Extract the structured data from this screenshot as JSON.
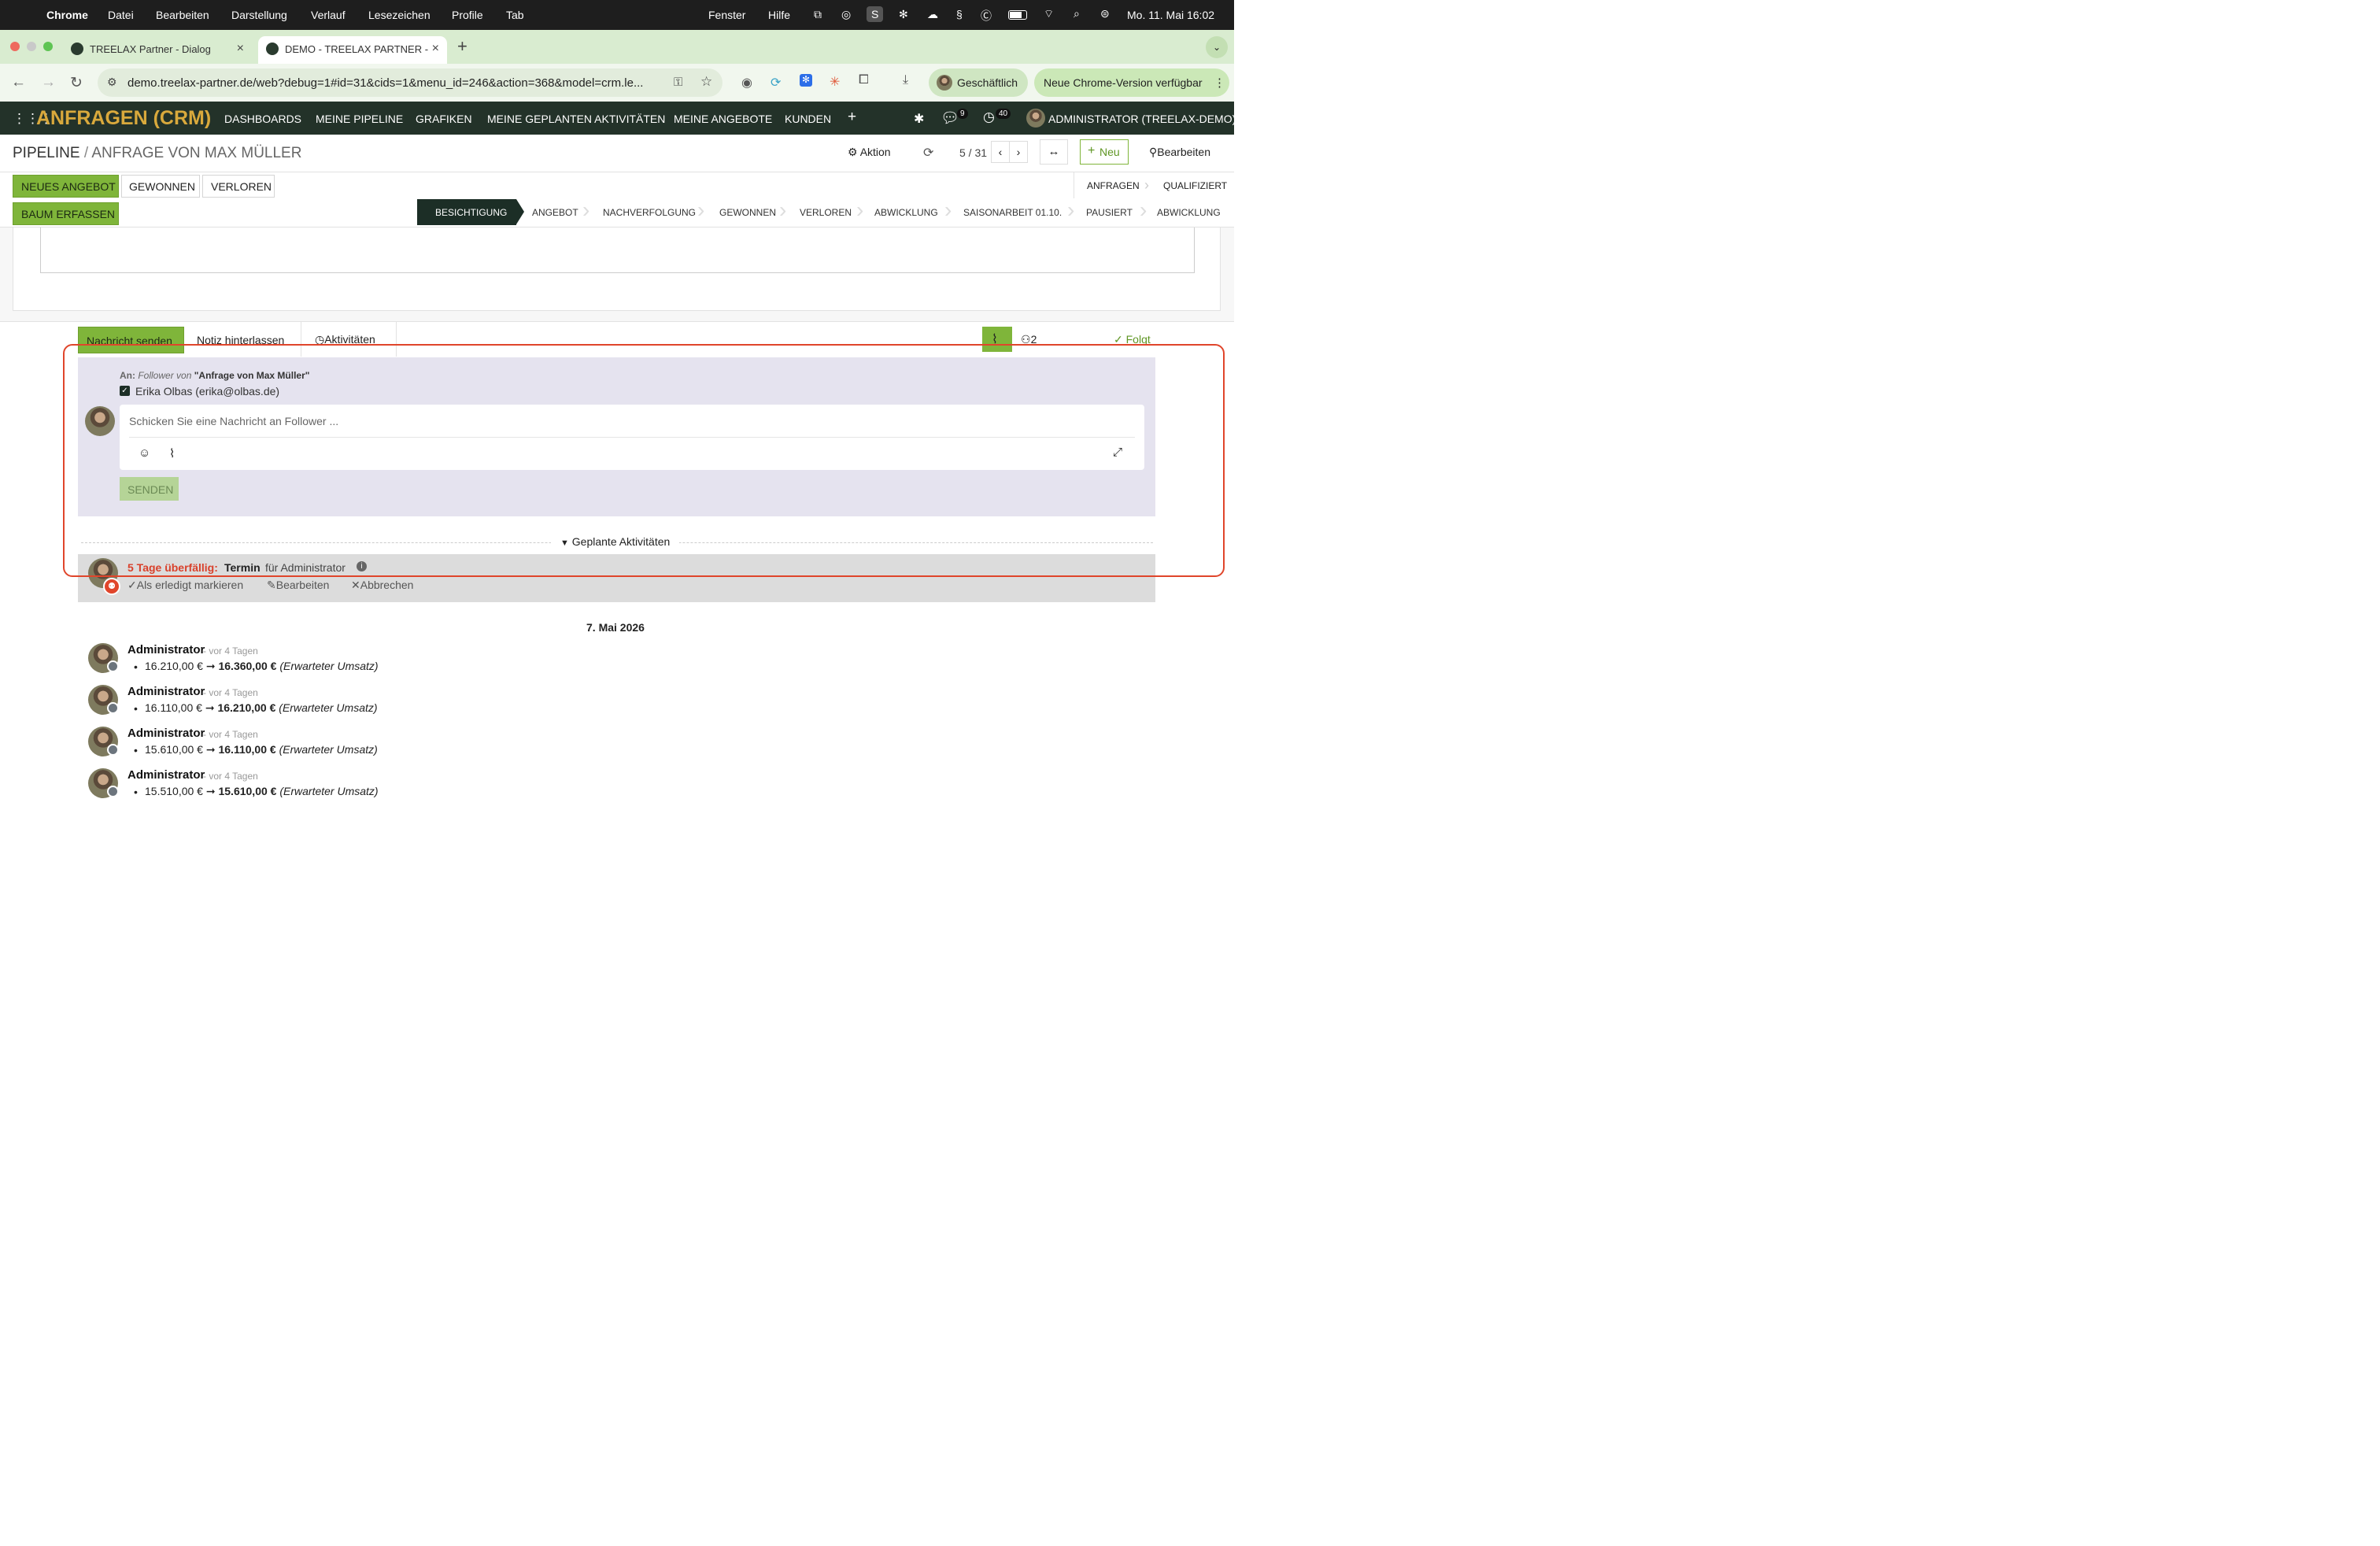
{
  "macos": {
    "app": "Chrome",
    "menus": [
      "Datei",
      "Bearbeiten",
      "Darstellung",
      "Verlauf",
      "Lesezeichen",
      "Profile",
      "Tab"
    ],
    "right_menus": [
      "Fenster",
      "Hilfe"
    ],
    "datetime": "Mo. 11. Mai  16:02"
  },
  "browser": {
    "tabs": [
      {
        "title": "TREELAX Partner - Dialog"
      },
      {
        "title": "DEMO - TREELAX PARTNER -"
      }
    ],
    "url": "demo.treelax-partner.de/web?debug=1#id=31&cids=1&menu_id=246&action=368&model=crm.le...",
    "profile_label": "Geschäftlich",
    "update_label": "Neue Chrome-Version verfügbar"
  },
  "odoo_nav": {
    "app_title": "ANFRAGEN (CRM)",
    "items": [
      "DASHBOARDS",
      "MEINE PIPELINE",
      "GRAFIKEN",
      "MEINE GEPLANTEN AKTIVITÄTEN",
      "MEINE ANGEBOTE",
      "KUNDEN"
    ],
    "messages_count": "9",
    "activities_count": "40",
    "user": "ADMINISTRATOR (TREELAX-DEMO)"
  },
  "control_panel": {
    "breadcrumb_root": "PIPELINE",
    "breadcrumb_sep": "/",
    "breadcrumb_current": "ANFRAGE VON MAX MÜLLER",
    "action_label": "Aktion",
    "pager": "5 / 31",
    "new_label": "Neu",
    "edit_label": "Bearbeiten"
  },
  "header_buttons": {
    "new_quote": "NEUES ANGEBOT",
    "won": "GEWONNEN",
    "lost": "VERLOREN",
    "capture_tree": "BAUM ERFASSEN"
  },
  "stages_top": [
    "ANFRAGEN",
    "QUALIFIZIERT"
  ],
  "stages": [
    "BESICHTIGUNG",
    "ANGEBOT",
    "NACHVERFOLGUNG",
    "GEWONNEN",
    "VERLOREN",
    "ABWICKLUNG",
    "SAISONARBEIT 01.10.",
    "PAUSIERT",
    "ABWICKLUNG"
  ],
  "chatter": {
    "tab_send": "Nachricht senden",
    "tab_note": "Notiz hinterlassen",
    "tab_activities": "Aktivitäten",
    "followers_count": "2",
    "follow_label": "Folgt",
    "to_prefix": "An:",
    "to_followers": "Follower von",
    "to_record": "\"Anfrage von Max Müller\"",
    "recipient": "Erika Olbas (erika@olbas.de)",
    "placeholder": "Schicken Sie eine Nachricht an Follower ...",
    "send_label": "SENDEN",
    "planned_label": "Geplante Aktivitäten",
    "activity": {
      "overdue": "5 Tage überfällig:",
      "type": "Termin",
      "for": "für Administrator",
      "mark_done": "Als erledigt markieren",
      "edit": "Bearbeiten",
      "cancel": "Abbrechen"
    },
    "date_separator": "7. Mai 2026",
    "messages": [
      {
        "author": "Administrator",
        "ago": "- vor 4 Tagen",
        "old": "16.210,00 €",
        "new": "16.360,00 €",
        "field": "(Erwarteter Umsatz)"
      },
      {
        "author": "Administrator",
        "ago": "- vor 4 Tagen",
        "old": "16.110,00 €",
        "new": "16.210,00 €",
        "field": "(Erwarteter Umsatz)"
      },
      {
        "author": "Administrator",
        "ago": "- vor 4 Tagen",
        "old": "15.610,00 €",
        "new": "16.110,00 €",
        "field": "(Erwarteter Umsatz)"
      },
      {
        "author": "Administrator",
        "ago": "- vor 4 Tagen",
        "old": "15.510,00 €",
        "new": "15.610,00 €",
        "field": "(Erwarteter Umsatz)"
      }
    ]
  },
  "colors": {
    "odoo_nav_bg": "#233229",
    "app_title": "#d9a93c",
    "brand_green": "#7fb53a",
    "overdue_red": "#d9412b",
    "highlight_frame": "#e0452b"
  }
}
